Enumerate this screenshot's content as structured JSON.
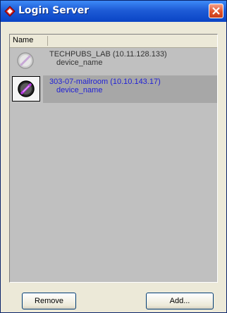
{
  "window": {
    "title": "Login Server"
  },
  "list": {
    "column_header": "Name",
    "rows": [
      {
        "name": "TECHPUBS_LAB (10.11.128.133)",
        "sub": "device_name",
        "state": "inactive"
      },
      {
        "name": "303-07-mailroom (10.10.143.17)",
        "sub": "device_name",
        "state": "active"
      }
    ]
  },
  "buttons": {
    "remove": "Remove",
    "add": "Add..."
  },
  "colors": {
    "titlebar": "#1e5cd6",
    "active_row_text": "#1f1fd6",
    "list_bg": "#c0c0c0",
    "window_bg": "#ece9d8"
  }
}
